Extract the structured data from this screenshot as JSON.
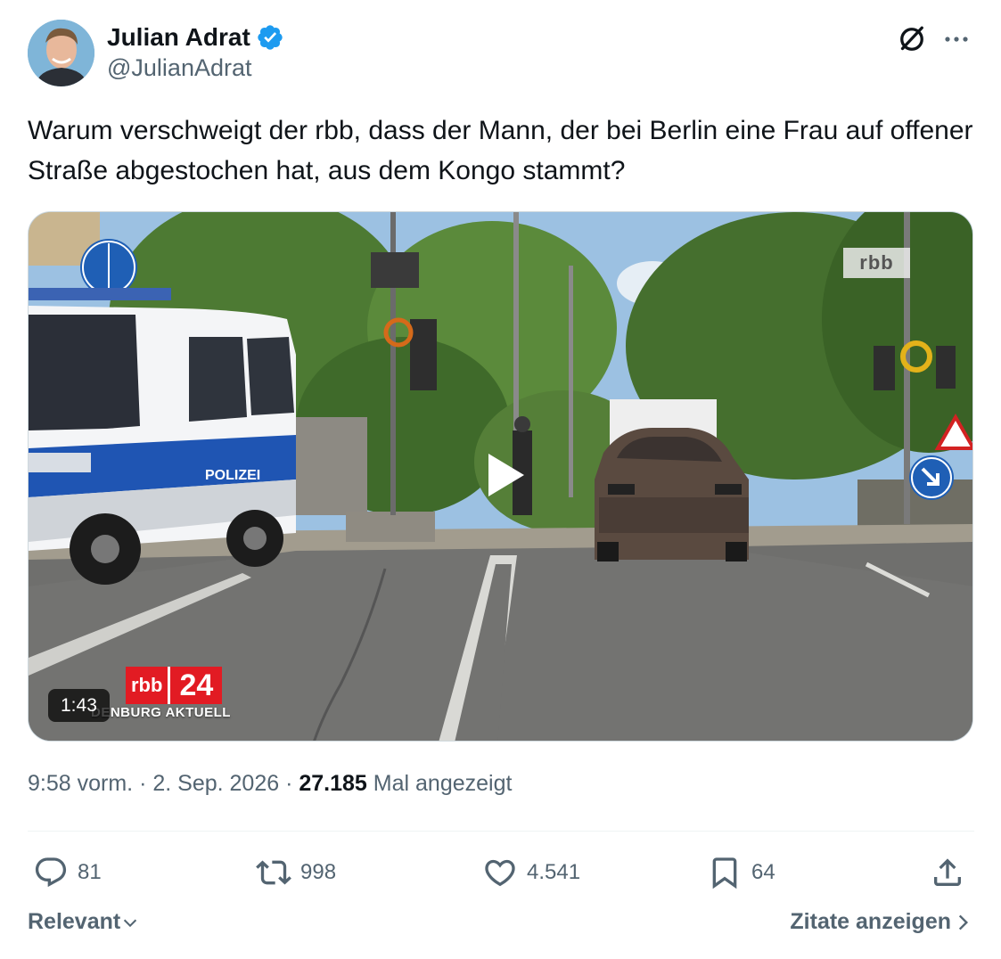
{
  "author": {
    "display_name": "Julian Adrat",
    "handle": "@JulianAdrat",
    "verified": true
  },
  "tweet": {
    "text": "Warum verschweigt der rbb, dass der Mann, der bei Berlin eine Frau auf offener Straße abgestochen hat, aus dem Kongo stammt?"
  },
  "media": {
    "duration": "1:43",
    "channel_logo": "rbb",
    "lower_third_brand": "rbb",
    "lower_third_number": "24",
    "lower_third_subtitle": "DENBURG AKTUELL",
    "van_label": "POLIZEI"
  },
  "meta": {
    "time": "9:58 vorm.",
    "separator": "·",
    "date": "2. Sep. 2026",
    "views_count": "27.185",
    "views_label": "Mal angezeigt"
  },
  "actions": {
    "replies": "81",
    "reposts": "998",
    "likes": "4.541",
    "bookmarks": "64"
  },
  "footer": {
    "sort_label": "Relevant",
    "quotes_label": "Zitate anzeigen"
  },
  "colors": {
    "text": "#0f1419",
    "secondary": "#536471",
    "verified": "#1d9bf0",
    "divider": "#eff3f4",
    "rbb_red": "#e21b23"
  },
  "icons": [
    "verified-badge-icon",
    "grok-icon",
    "more-icon",
    "play-icon",
    "reply-icon",
    "repost-icon",
    "like-icon",
    "bookmark-icon",
    "share-icon",
    "chevron-down-icon",
    "chevron-right-icon"
  ]
}
